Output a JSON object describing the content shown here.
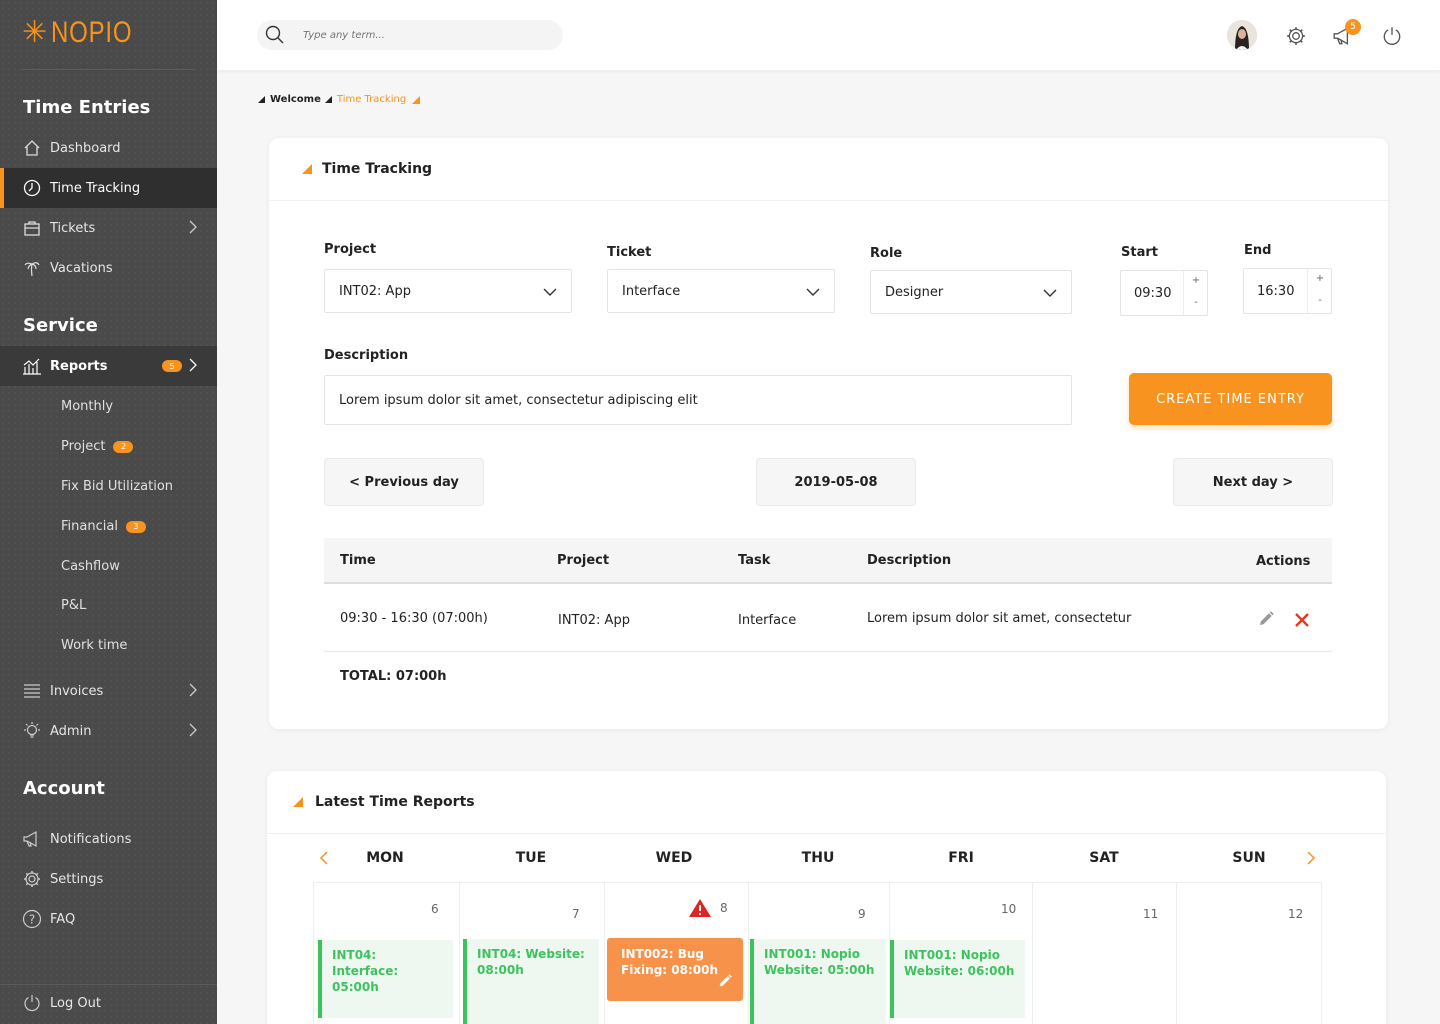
{
  "app": {
    "logo_text": "NOPIO",
    "brand_color": "#f7931e"
  },
  "sidebar": {
    "sections": {
      "time_entries": "Time Entries",
      "service": "Service",
      "account": "Account"
    },
    "time_entries": [
      {
        "label": "Dashboard",
        "icon": "home-icon"
      },
      {
        "label": "Time Tracking",
        "icon": "clock-icon"
      },
      {
        "label": "Tickets",
        "icon": "briefcase-icon"
      },
      {
        "label": "Vacations",
        "icon": "palm-tree-icon"
      }
    ],
    "reports": {
      "label": "Reports",
      "badge": "5"
    },
    "report_items": [
      {
        "label": "Monthly"
      },
      {
        "label": "Project",
        "badge": "2"
      },
      {
        "label": "Fix Bid Utilization"
      },
      {
        "label": "Financial",
        "badge": "3"
      },
      {
        "label": "Cashflow"
      },
      {
        "label": "P&L"
      },
      {
        "label": "Work time"
      }
    ],
    "invoices": "Invoices",
    "admin": "Admin",
    "account_items": [
      {
        "label": "Notifications",
        "icon": "megaphone-icon"
      },
      {
        "label": "Settings",
        "icon": "gear-icon"
      },
      {
        "label": "FAQ",
        "icon": "question-icon"
      }
    ],
    "logout": "Log Out"
  },
  "header": {
    "search_placeholder": "Type any term...",
    "notification_count": "5"
  },
  "breadcrumb": {
    "root": "Welcome",
    "current": "Time Tracking"
  },
  "time_tracking": {
    "title": "Time Tracking",
    "project_label": "Project",
    "project_value": "INT02: App",
    "ticket_label": "Ticket",
    "ticket_value": "Interface",
    "role_label": "Role",
    "role_value": "Designer",
    "start_label": "Start",
    "start_value": "09:30",
    "end_label": "End",
    "end_value": "16:30",
    "plus": "+",
    "minus": "-",
    "description_label": "Description",
    "description_value": "Lorem ipsum dolor sit amet, consectetur adipiscing elit",
    "create_button": "CREATE TIME ENTRY",
    "prev_day": "< Previous day",
    "current_date": "2019-05-08",
    "next_day": "Next day >",
    "table": {
      "headers": {
        "time": "Time",
        "project": "Project",
        "task": "Task",
        "description": "Description",
        "actions": "Actions"
      },
      "rows": [
        {
          "time": "09:30 - 16:30 (07:00h)",
          "project": "INT02: App",
          "task": "Interface",
          "description": "Lorem ipsum dolor sit amet, consectetur"
        }
      ],
      "total": "TOTAL: 07:00h"
    }
  },
  "latest_reports": {
    "title": "Latest Time Reports",
    "days": [
      "MON",
      "TUE",
      "WED",
      "THU",
      "FRI",
      "SAT",
      "SUN"
    ],
    "dates": [
      "6",
      "7",
      "8",
      "9",
      "10",
      "11",
      "12"
    ],
    "events": {
      "mon": "INT04: Interface: 05:00h",
      "tue": "INT04: Website: 08:00h",
      "wed": "INT002: Bug Fixing: 08:00h",
      "thu": "INT001: Nopio Website: 05:00h",
      "fri": "INT001: Nopio Website: 06:00h"
    },
    "event_color": "#3dc35e",
    "warning_color": "#e02424"
  }
}
